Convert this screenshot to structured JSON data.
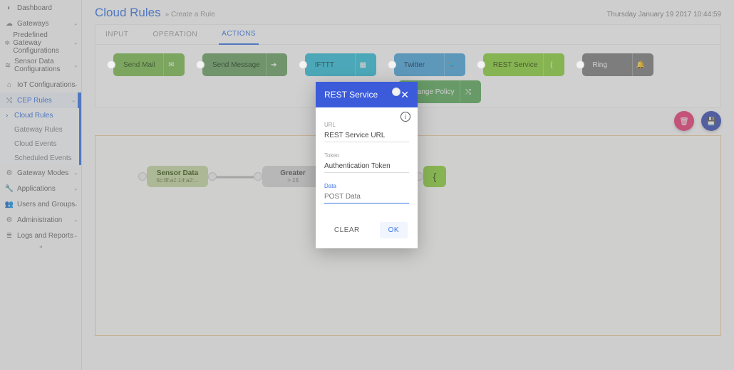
{
  "sidebar": {
    "items": [
      {
        "icon": "dashboard",
        "label": "Dashboard",
        "expandable": false
      },
      {
        "icon": "cloud",
        "label": "Gateways",
        "expandable": true
      },
      {
        "icon": "sliders",
        "label": "Predefined Gateway Configurations",
        "expandable": true,
        "multiline": true
      },
      {
        "icon": "signal",
        "label": "Sensor Data Configurations",
        "expandable": true,
        "multiline": true
      },
      {
        "icon": "iot",
        "label": "IoT Configurations",
        "expandable": true
      },
      {
        "icon": "shuffle",
        "label": "CEP Rules",
        "expandable": true,
        "active": true,
        "children": [
          {
            "label": "Cloud Rules",
            "selected": true
          },
          {
            "label": "Gateway Rules"
          },
          {
            "label": "Cloud Events"
          },
          {
            "label": "Scheduled Events"
          }
        ]
      },
      {
        "icon": "gear",
        "label": "Gateway Modes",
        "expandable": true
      },
      {
        "icon": "wrench",
        "label": "Applications",
        "expandable": true
      },
      {
        "icon": "users",
        "label": "Users and Groups",
        "expandable": true
      },
      {
        "icon": "gear",
        "label": "Administration",
        "expandable": true
      },
      {
        "icon": "list",
        "label": "Logs and Reports",
        "expandable": true
      }
    ]
  },
  "header": {
    "title": "Cloud Rules",
    "breadcrumb": "» Create a Rule",
    "datetime": "Thursday January 19 2017 10:44:59"
  },
  "tabs": [
    {
      "label": "INPUT"
    },
    {
      "label": "OPERATION"
    },
    {
      "label": "ACTIONS",
      "active": true
    }
  ],
  "action_nodes_row1": [
    {
      "label": "Send Mail",
      "style": "green",
      "icon": "mail"
    },
    {
      "label": "Send Message",
      "style": "olive",
      "icon": "arrow"
    },
    {
      "label": "IFTTT",
      "style": "teal",
      "icon": "grid"
    },
    {
      "label": "Twitter",
      "style": "blue",
      "icon": "twitter"
    },
    {
      "label": "REST Service",
      "style": "lime",
      "icon": "brace"
    },
    {
      "label": "Ring",
      "style": "gray",
      "icon": "bell"
    }
  ],
  "action_nodes_row2": [
    {
      "label": "Change Policy",
      "style": "green2",
      "icon": "shuffle"
    }
  ],
  "canvas_nodes": {
    "sensor": {
      "title": "Sensor Data",
      "subtitle": "5c:f8:a1:14:a2:..."
    },
    "greater": {
      "title": "Greater",
      "subtitle": "> 15"
    }
  },
  "modal": {
    "title": "REST Service",
    "fields": {
      "url": {
        "label": "URL",
        "value": "REST Service URL"
      },
      "token": {
        "label": "Token",
        "value": "Authentication Token"
      },
      "data": {
        "label": "Data",
        "placeholder": "POST Data"
      }
    },
    "buttons": {
      "clear": "CLEAR",
      "ok": "OK"
    }
  }
}
